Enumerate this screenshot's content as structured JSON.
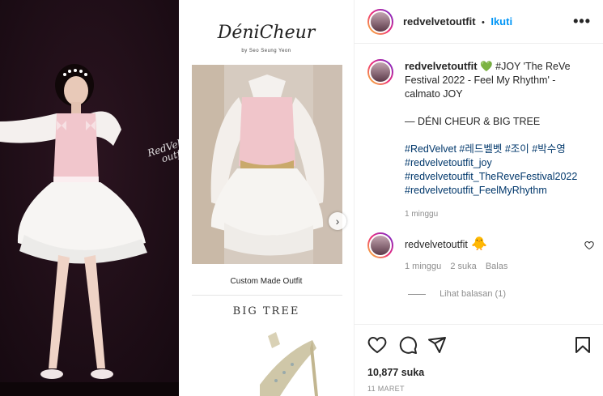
{
  "media": {
    "watermark_line1": "RedVelvet",
    "watermark_line2": "outfit",
    "brand_title": "DéniCheur",
    "brand_subtitle": "by Seo Seung Yeon",
    "caption": "Custom Made Outfit",
    "second_brand": "BIG TREE"
  },
  "header": {
    "username": "redvelvetoutfit",
    "separator": "•",
    "follow_label": "Ikuti",
    "more_icon": "more-dots-icon"
  },
  "post": {
    "username": "redvelvetoutfit",
    "heart": "💚",
    "caption_line": "#JOY 'The ReVe Festival 2022 - Feel My Rhythm' - calmato JOY",
    "credit": "— DÉNI CHEUR & BIG TREE",
    "hashtags": [
      "#RedVelvet #레드벨벳 #조이 #박수영",
      "#redvelvetoutfit_joy",
      "#redvelvetoutfit_TheReveFestival2022",
      "#redvelvetoutfit_FeelMyRhythm"
    ],
    "time": "1 minggu"
  },
  "comment": {
    "username": "redvelvetoutfit",
    "emoji": "🐥",
    "time": "1 minggu",
    "likes": "2 suka",
    "reply": "Balas",
    "view_replies": "Lihat balasan (1)"
  },
  "actions": {
    "likes": "10,877 suka",
    "date": "11 MARET"
  },
  "colors": {
    "accent": "#0095f6",
    "hashtag": "#00376b",
    "muted": "#8e8e8e",
    "left_bg": "#1d0e15"
  }
}
